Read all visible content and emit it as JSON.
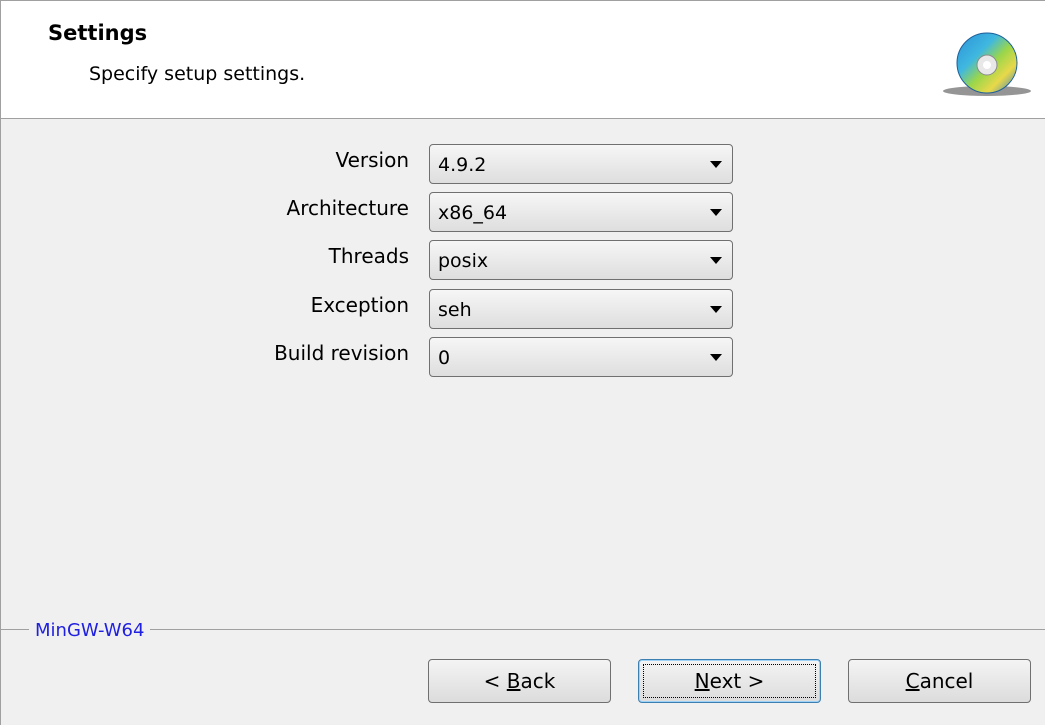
{
  "header": {
    "title": "Settings",
    "subtitle": "Specify setup settings.",
    "icon": "cd-disc-icon"
  },
  "form": {
    "fields": [
      {
        "label": "Version",
        "value": "4.9.2"
      },
      {
        "label": "Architecture",
        "value": "x86_64"
      },
      {
        "label": "Threads",
        "value": "posix"
      },
      {
        "label": "Exception",
        "value": "seh"
      },
      {
        "label": "Build revision",
        "value": "0"
      }
    ]
  },
  "footer": {
    "group_label": "MinGW-W64",
    "group_label_color": "#2020e0",
    "buttons": {
      "back": {
        "prefix": "< ",
        "mnemonic": "B",
        "rest": "ack"
      },
      "next": {
        "prefix": "",
        "mnemonic": "N",
        "rest": "ext >"
      },
      "cancel": {
        "prefix": "",
        "mnemonic": "C",
        "rest": "ancel"
      }
    }
  }
}
